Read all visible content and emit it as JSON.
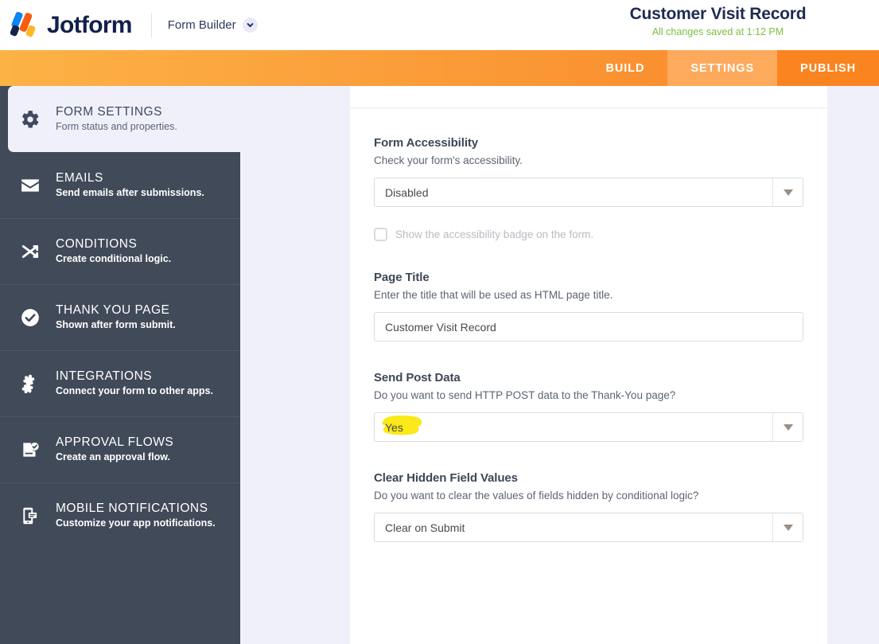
{
  "header": {
    "brand": "Jotform",
    "product_menu": "Form Builder",
    "form_title": "Customer Visit Record",
    "save_status": "All changes saved at 1:12 PM"
  },
  "nav": {
    "tabs": [
      {
        "label": "BUILD",
        "active": false
      },
      {
        "label": "SETTINGS",
        "active": true
      },
      {
        "label": "PUBLISH",
        "active": false
      }
    ]
  },
  "sidebar": {
    "items": [
      {
        "title": "FORM SETTINGS",
        "desc": "Form status and properties.",
        "icon": "gear-icon",
        "active": true
      },
      {
        "title": "EMAILS",
        "desc": "Send emails after submissions.",
        "icon": "envelope-icon",
        "active": false
      },
      {
        "title": "CONDITIONS",
        "desc": "Create conditional logic.",
        "icon": "shuffle-icon",
        "active": false
      },
      {
        "title": "THANK YOU PAGE",
        "desc": "Shown after form submit.",
        "icon": "check-circle-icon",
        "active": false
      },
      {
        "title": "INTEGRATIONS",
        "desc": "Connect your form to other apps.",
        "icon": "puzzle-icon",
        "active": false
      },
      {
        "title": "APPROVAL FLOWS",
        "desc": "Create an approval flow.",
        "icon": "approval-document-icon",
        "active": false
      },
      {
        "title": "MOBILE NOTIFICATIONS",
        "desc": "Customize your app notifications.",
        "icon": "mobile-bell-icon",
        "active": false
      }
    ]
  },
  "settings": {
    "accessibility": {
      "label": "Form Accessibility",
      "desc": "Check your form's accessibility.",
      "value": "Disabled",
      "checkbox_label": "Show the accessibility badge on the form.",
      "checkbox_checked": false
    },
    "page_title": {
      "label": "Page Title",
      "desc": "Enter the title that will be used as HTML page title.",
      "value": "Customer Visit Record"
    },
    "send_post_data": {
      "label": "Send Post Data",
      "desc": "Do you want to send HTTP POST data to the Thank-You page?",
      "value": "Yes",
      "highlighted": true,
      "highlight_color": "#fbe919"
    },
    "clear_hidden": {
      "label": "Clear Hidden Field Values",
      "desc": "Do you want to clear the values of fields hidden by conditional logic?",
      "value": "Clear on Submit"
    }
  },
  "colors": {
    "nav_orange": "#fa8f2f",
    "nav_active": "#fdaa5c",
    "sidebar_dark": "#414a59",
    "page_bg": "#f0f0fa",
    "save_green": "#7bc043",
    "brand_navy": "#12204b"
  }
}
